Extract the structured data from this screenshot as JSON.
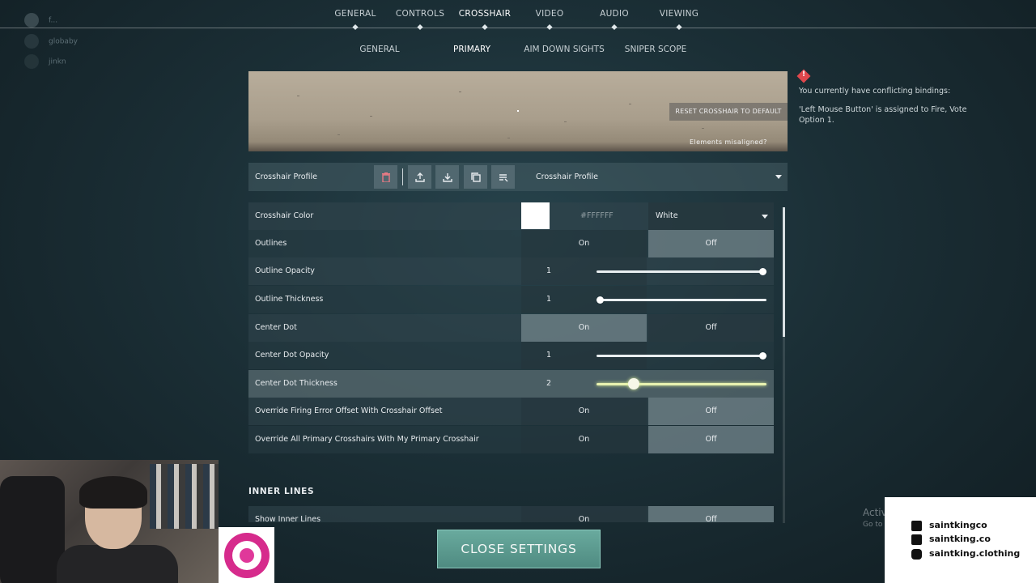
{
  "top_nav": {
    "tabs": [
      "GENERAL",
      "CONTROLS",
      "CROSSHAIR",
      "VIDEO",
      "AUDIO",
      "VIEWING"
    ],
    "active": "CROSSHAIR"
  },
  "sub_nav": {
    "tabs": [
      "GENERAL",
      "PRIMARY",
      "AIM DOWN SIGHTS",
      "SNIPER SCOPE"
    ],
    "active": "PRIMARY"
  },
  "players": [
    "f...",
    "globaby",
    "jinkn"
  ],
  "preview": {
    "reset_label": "RESET CROSSHAIR TO DEFAULT",
    "misaligned_label": "Elements misaligned?"
  },
  "profile": {
    "label": "Crosshair Profile",
    "selected": "Crosshair Profile",
    "icons": [
      "trash-icon",
      "upload-icon",
      "download-icon",
      "copy-icon",
      "list-icon"
    ]
  },
  "settings": {
    "crosshair_color": {
      "label": "Crosshair Color",
      "hex": "#FFFFFF",
      "selected": "White",
      "swatch": "#ffffff"
    },
    "outlines": {
      "label": "Outlines",
      "on": "On",
      "off": "Off",
      "value": "Off"
    },
    "outline_opacity": {
      "label": "Outline Opacity",
      "value": "1",
      "level": 1.0
    },
    "outline_thickness": {
      "label": "Outline Thickness",
      "value": "1",
      "level": 0.0
    },
    "center_dot": {
      "label": "Center Dot",
      "on": "On",
      "off": "Off",
      "value": "On"
    },
    "center_dot_opacity": {
      "label": "Center Dot Opacity",
      "value": "1",
      "level": 1.0
    },
    "center_dot_thickness": {
      "label": "Center Dot Thickness",
      "value": "2",
      "level": 0.2
    },
    "override_firing": {
      "label": "Override Firing Error Offset With Crosshair Offset",
      "on": "On",
      "off": "Off",
      "value": "Off"
    },
    "override_primary": {
      "label": "Override All Primary Crosshairs With My Primary Crosshair",
      "on": "On",
      "off": "Off",
      "value": "Off"
    }
  },
  "inner_lines": {
    "title": "INNER LINES",
    "show_inner_lines": {
      "label": "Show Inner Lines",
      "on": "On",
      "off": "Off",
      "value": "Off"
    }
  },
  "warning": {
    "line1": "You currently have conflicting bindings:",
    "line2": "'Left Mouse Button' is assigned to Fire, Vote",
    "line3": "Option 1."
  },
  "close_label": "CLOSE SETTINGS",
  "watermark": {
    "line1": "Activ",
    "line2": "Go to"
  },
  "social": {
    "facebook": "saintkingco",
    "tiktok": "saintking.co",
    "instagram": "saintking.clothing"
  },
  "colors": {
    "accent": "#69aa9e",
    "warning": "#e0474c",
    "slider_active": "#e8f2b0"
  }
}
